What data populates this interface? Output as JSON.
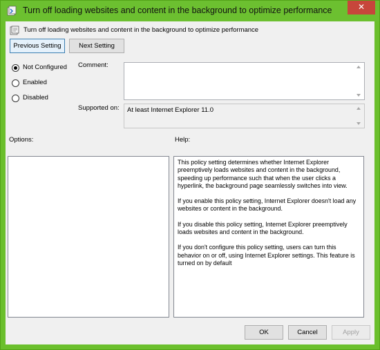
{
  "window": {
    "title": "Turn off loading websites and content in the background to optimize performance",
    "close_glyph": "✕",
    "accent_color": "#6cc030"
  },
  "header": {
    "policy_name": "Turn off loading websites and content in the background to optimize performance"
  },
  "nav": {
    "previous_label": "Previous Setting",
    "next_label": "Next Setting"
  },
  "state": {
    "options": [
      {
        "label": "Not Configured",
        "selected": true
      },
      {
        "label": "Enabled",
        "selected": false
      },
      {
        "label": "Disabled",
        "selected": false
      }
    ]
  },
  "comment": {
    "label": "Comment:",
    "value": ""
  },
  "supported": {
    "label": "Supported on:",
    "value": "At least Internet Explorer 11.0"
  },
  "options_panel": {
    "label": "Options:"
  },
  "help_panel": {
    "label": "Help:",
    "paragraphs": [
      "This policy setting determines whether Internet Explorer preemptively loads websites and content in the background, speeding up performance such that when the user clicks a hyperlink, the background page seamlessly switches into view.",
      "If you enable this policy setting, Internet Explorer doesn't load any websites or content in the background.",
      "If you disable this policy setting, Internet Explorer preemptively loads websites and content in the background.",
      "If you don't configure this policy setting, users can turn this behavior on or off, using Internet Explorer settings. This feature is turned on by default"
    ]
  },
  "footer": {
    "ok_label": "OK",
    "cancel_label": "Cancel",
    "apply_label": "Apply"
  }
}
